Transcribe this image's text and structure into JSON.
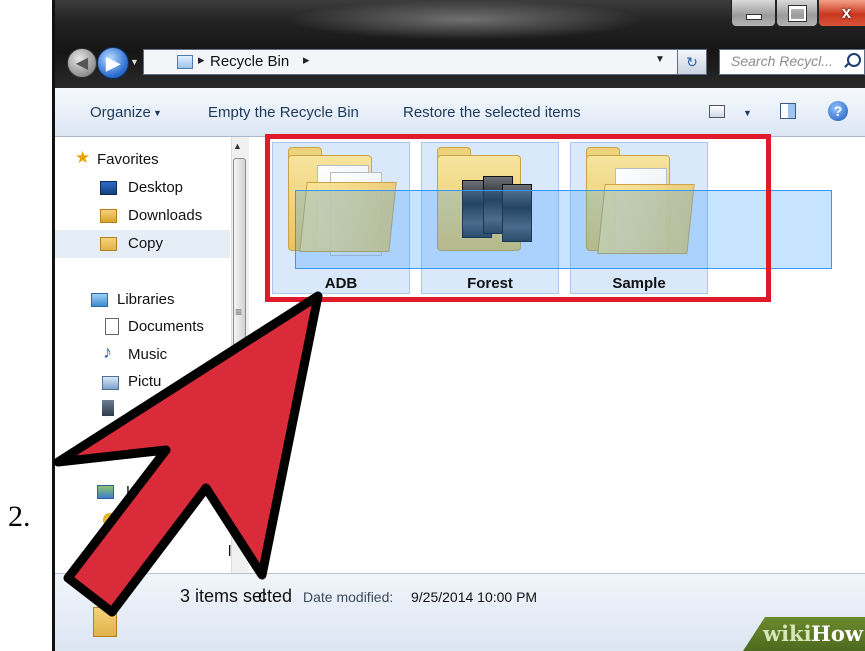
{
  "step_number": "2.",
  "window": {
    "minimize_glyph": "minimize-icon",
    "maximize_glyph": "maximize-icon",
    "close_glyph": "x"
  },
  "address_bar": {
    "separator": "▸",
    "location": "Recycle Bin",
    "search_placeholder": "Search Recycl..."
  },
  "toolbar": {
    "organize": "Organize",
    "empty_bin": "Empty the Recycle Bin",
    "restore": "Restore the selected items",
    "help": "?"
  },
  "sidebar": {
    "favorites": "Favorites",
    "desktop": "Desktop",
    "downloads": "Downloads",
    "copy": "Copy",
    "libraries": "Libraries",
    "documents": "Documents",
    "music": "Music",
    "pictures_partial": "Pictu",
    "homegroup_partial": "L",
    "volume_partial": "lume"
  },
  "folders": [
    {
      "name": "ADB"
    },
    {
      "name": "Forest"
    },
    {
      "name": "Sample"
    }
  ],
  "status": {
    "selected_a": "3 items sel",
    "selected_b": "cted",
    "date_label": "Date modified:",
    "date_value": "9/25/2014 10:00 PM"
  },
  "watermark": {
    "wiki": "wiki",
    "how": "How"
  },
  "colors": {
    "highlight_box": "#e0192b",
    "arrow_fill": "#d92b3a",
    "selection": "#3399ff"
  }
}
